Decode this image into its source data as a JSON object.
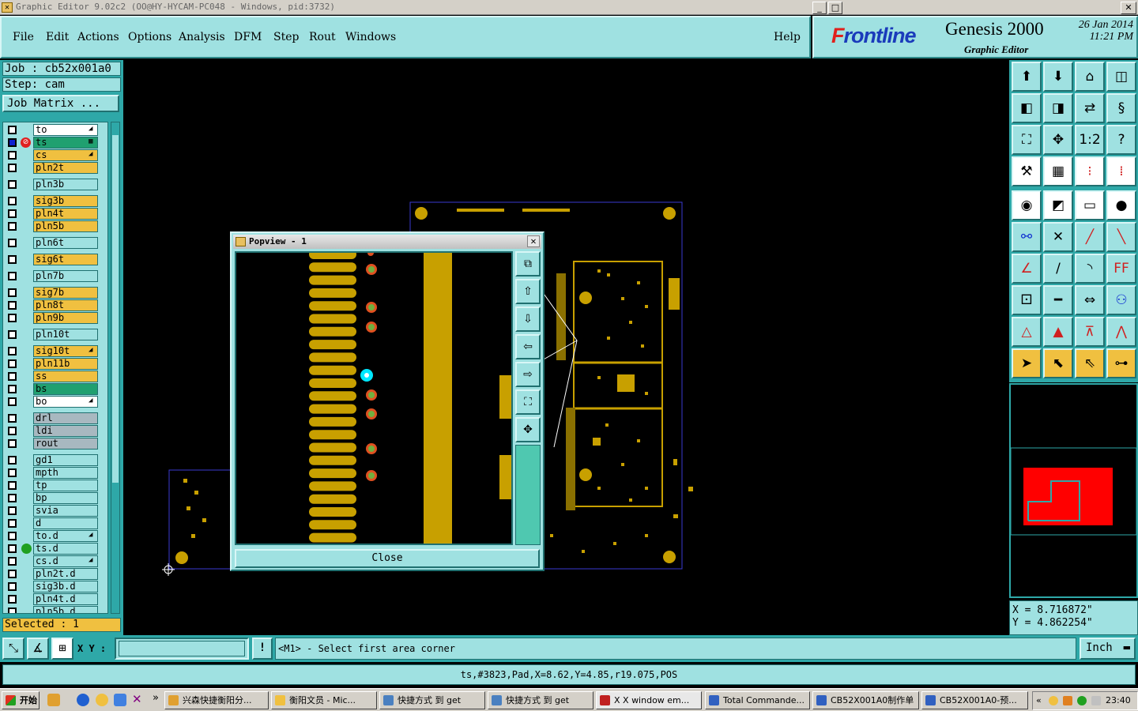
{
  "window": {
    "title": "Graphic Editor 9.02c2  (OO@HY-HYCAM-PC048 - Windows, pid:3732)"
  },
  "menu": [
    "File",
    "Edit",
    "Actions",
    "Options",
    "Analysis",
    "DFM",
    "Step",
    "Rout",
    "Windows"
  ],
  "help_label": "Help",
  "brand": {
    "logo_prefix": "F",
    "logo_rest": "rontline",
    "product": "Genesis 2000",
    "subtitle": "Graphic Editor",
    "date": "26 Jan 2014",
    "time": "11:21 PM"
  },
  "job": {
    "job_label": "Job : cb52x001a0",
    "step_label": "Step: cam",
    "matrix_button": "Job Matrix ..."
  },
  "layers": [
    {
      "name": "to",
      "style": "wh",
      "arrow": "◢"
    },
    {
      "name": "ts",
      "style": "sm",
      "arrow": "▦",
      "active": true
    },
    {
      "name": "cs",
      "style": "sig",
      "arrow": "◢"
    },
    {
      "name": "pln2t",
      "style": "sig"
    },
    {
      "name": "pln3b",
      "style": "pl",
      "gap": true
    },
    {
      "name": "sig3b",
      "style": "sig",
      "gap": true
    },
    {
      "name": "pln4t",
      "style": "sig"
    },
    {
      "name": "pln5b",
      "style": "sig"
    },
    {
      "name": "pln6t",
      "style": "pl",
      "gap": true
    },
    {
      "name": "sig6t",
      "style": "sig",
      "gap": true
    },
    {
      "name": "pln7b",
      "style": "pl",
      "gap": true
    },
    {
      "name": "sig7b",
      "style": "sig",
      "gap": true
    },
    {
      "name": "pln8t",
      "style": "sig"
    },
    {
      "name": "pln9b",
      "style": "sig"
    },
    {
      "name": "pln10t",
      "style": "pl",
      "gap": true
    },
    {
      "name": "sig10t",
      "style": "sig",
      "gap": true,
      "arrow": "◢"
    },
    {
      "name": "pln11b",
      "style": "sig"
    },
    {
      "name": "ss",
      "style": "sig"
    },
    {
      "name": "bs",
      "style": "sm"
    },
    {
      "name": "bo",
      "style": "wh",
      "arrow": "◢"
    },
    {
      "name": "drl",
      "style": "gr",
      "gap": true
    },
    {
      "name": "ldi",
      "style": "gr"
    },
    {
      "name": "rout",
      "style": "gr"
    },
    {
      "name": "gd1",
      "style": "pl",
      "gap": true
    },
    {
      "name": "mpth",
      "style": "pl"
    },
    {
      "name": "tp",
      "style": "pl"
    },
    {
      "name": "bp",
      "style": "pl"
    },
    {
      "name": "svia",
      "style": "pl"
    },
    {
      "name": "d",
      "style": "pl"
    },
    {
      "name": "to.d",
      "style": "pl",
      "arrow": "◢"
    },
    {
      "name": "ts.d",
      "style": "pl",
      "dot": true
    },
    {
      "name": "cs.d",
      "style": "pl",
      "arrow": "◢"
    },
    {
      "name": "pln2t.d",
      "style": "pl"
    },
    {
      "name": "sig3b.d",
      "style": "pl"
    },
    {
      "name": "pln4t.d",
      "style": "pl"
    },
    {
      "name": "pln5b.d",
      "style": "pl"
    }
  ],
  "selected": "Selected : 1",
  "coords": {
    "x": "X = 8.716872\"",
    "y": "Y = 4.862254\""
  },
  "xy_label": "X Y :",
  "xy_value": "",
  "prompt": "<M1> - Select first area corner",
  "units": "Inch",
  "status": "ts,#3823,Pad,X=8.62,Y=4.85,r19.075,POS",
  "popup": {
    "title": "Popview - 1",
    "close": "Close"
  },
  "tool_icons": [
    "save",
    "load",
    "home",
    "frame",
    "left-page",
    "right-page",
    "swap",
    "s-shape",
    "fit",
    "zoom-center",
    "ratio",
    "help",
    "measure",
    "grid",
    "snap-red",
    "snap-red2",
    "pin",
    "draw",
    "ruler",
    "circle",
    "net",
    "cross",
    "line-red",
    "line-red2",
    "angle",
    "slash",
    "arc",
    "ff",
    "step",
    "minus",
    "scale",
    "multi",
    "tri",
    "tri2",
    "tri3",
    "tri4",
    "cursor",
    "cursor2",
    "cursor3",
    "route"
  ],
  "taskbar": {
    "start": "开始",
    "time": "23:40",
    "tasks": [
      "兴森快捷衡阳分...",
      "衡阳文员 - Mic...",
      "快捷方式 到 get",
      "快捷方式 到 get",
      "X X window em...",
      "Total Commande...",
      "CB52X001A0制作单",
      "CB52X001A0-预..."
    ]
  }
}
